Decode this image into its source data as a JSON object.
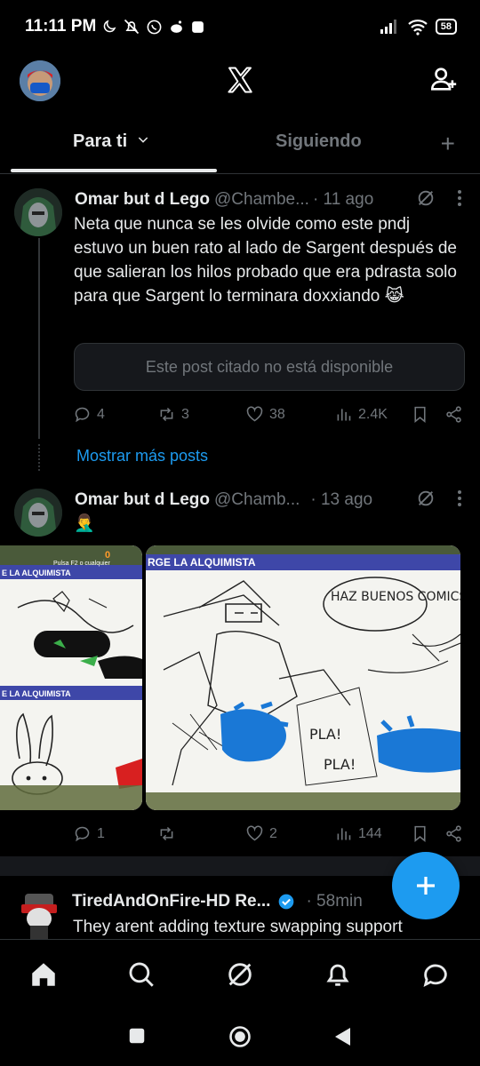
{
  "status_bar": {
    "time": "11:11 PM",
    "battery": "58",
    "left_icons": [
      "moon-icon",
      "notifications-off-icon",
      "whatsapp-icon",
      "reddit-icon",
      "app-square-icon"
    ],
    "right_icons": [
      "signal-icon",
      "wifi-icon",
      "battery-icon"
    ]
  },
  "header": {
    "logo": "X",
    "icons": [
      "profile-avatar",
      "x-logo-icon",
      "follow-suggestions-icon"
    ]
  },
  "tabs": {
    "for_you": "Para ti",
    "following": "Siguiendo",
    "add": "+"
  },
  "posts": [
    {
      "name": "Omar but d Lego",
      "handle": "@Chambe...",
      "time": "· 11 ago",
      "text": "Neta que nunca se les olvide como este pndj estuvo un buen rato al lado de Sargent después de que salieran los hilos probado que era pdrasta solo para que Sargent lo terminara doxxiando 😹",
      "quote": "Este post citado no está disponible",
      "replies": "4",
      "reposts": "3",
      "likes": "38",
      "views": "2.4K"
    },
    {
      "name": "Omar but d Lego",
      "handle": "@Chamb...",
      "time": "· 13 ago",
      "text": "🤦‍♂️",
      "replies": "1",
      "reposts": "",
      "likes": "2",
      "views": "144",
      "media_left_texts": [
        "E LA ALQUIMISTA",
        "Pulsa F2 o cualquier",
        "0",
        "E LA ALQUIMISTA"
      ],
      "media_right_texts": [
        "RGE LA ALQUIMISTA",
        "HAZ BUENOS COMICS, FURRA",
        "PLA!",
        "PLA!"
      ]
    },
    {
      "name": "TiredAndOnFire-HD Re...",
      "time": "· 58min",
      "text": "They arent adding texture swapping support"
    }
  ],
  "show_more": "Mostrar más posts",
  "fab": "+",
  "bottom_nav": [
    "home-icon",
    "search-icon",
    "grok-icon",
    "notifications-icon",
    "messages-icon"
  ],
  "colors": {
    "accent": "#1d9bf0",
    "background": "#000000",
    "text": "#e7e9ea",
    "secondary": "#71767b"
  }
}
